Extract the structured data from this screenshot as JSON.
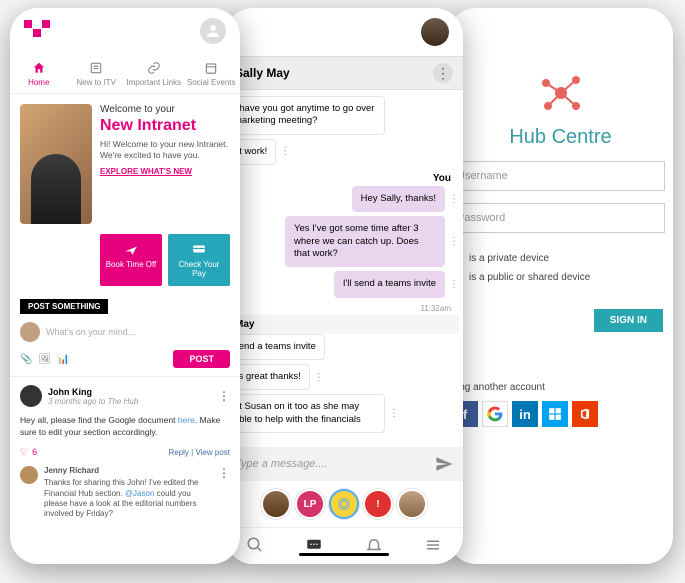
{
  "p1": {
    "tabs": [
      {
        "label": "Home"
      },
      {
        "label": "New to ITV"
      },
      {
        "label": "Important Links"
      },
      {
        "label": "Social Events"
      }
    ],
    "hero": {
      "welcome": "Welcome to your",
      "title": "New Intranet",
      "sub": "Hi! Welcome to your new Intranet. We're excited to have you.",
      "link": "EXPLORE WHAT'S NEW"
    },
    "actions": {
      "book": "Book Time Off",
      "pay": "Check Your Pay"
    },
    "post": {
      "label": "POST SOMETHING",
      "placeholder": "What's on your mind...",
      "button": "POST"
    },
    "feed": {
      "author": "John King",
      "meta": "3 months ago to The Hub",
      "body1": "Hey all, please find the Google document ",
      "body_link": "here",
      "body2": ". Make sure to edit your section accordingly.",
      "likes": "6",
      "reply": "Reply",
      "view": "View post",
      "comment_author": "Jenny Richard",
      "comment1": "Thanks for sharing this John! I've edited the Financial Hub section. ",
      "comment_mention": "@Jason",
      "comment2": " could you please have a look at the editorial numbers involved by Friday?"
    }
  },
  "p2": {
    "contact": "Sally May",
    "you_label": "You",
    "msgs": {
      "m1": ", have you got anytime to go over marketing meeting?",
      "m2": "at work!",
      "m3": "Hey Sally, thanks!",
      "m4": "Yes I've got some time after 3 where we can catch up. Does that work?",
      "m5": "I'll send a teams invite",
      "m6": "send a teams invite",
      "m7": "t's great thanks!",
      "m8": "et Susan on it too as she may able to help with the financials"
    },
    "timestamp": "11:32am",
    "group_label": "May",
    "input_placeholder": "Type a message....",
    "strip": {
      "lp": "LP"
    }
  },
  "p3": {
    "title": "Hub Centre",
    "username_ph": "Username",
    "password_ph": "Password",
    "radio1": "is a private device",
    "radio2": "is a public or shared device",
    "signin": "SIGN IN",
    "alt": "sing another account",
    "sso": {
      "f": "f",
      "g": "G",
      "in": "in"
    }
  }
}
